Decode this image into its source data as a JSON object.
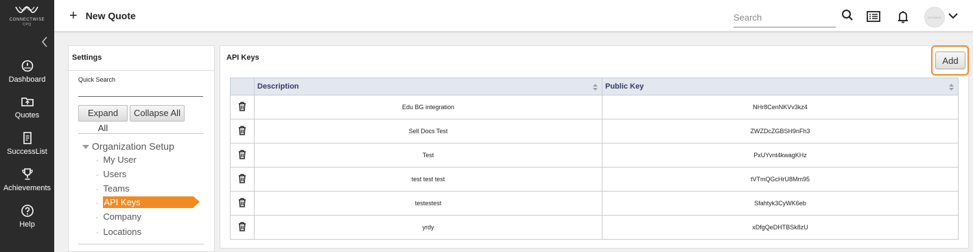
{
  "sidebar": {
    "logo": {
      "line1": "CONNECTWISE",
      "line2": "CPQ"
    },
    "items": [
      {
        "label": "Dashboard",
        "icon": "dashboard-gauge-icon"
      },
      {
        "label": "Quotes",
        "icon": "quotes-folder-icon"
      },
      {
        "label": "SuccessList",
        "icon": "successlist-clipboard-icon"
      },
      {
        "label": "Achievements",
        "icon": "trophy-icon"
      },
      {
        "label": "Help",
        "icon": "help-question-icon"
      }
    ]
  },
  "topbar": {
    "new_quote_label": "New Quote",
    "search_placeholder": "Search",
    "avatar_text": "NO IMAGE"
  },
  "settings": {
    "title": "Settings",
    "quick_search_label": "Quick Search",
    "expand_all": "Expand All",
    "collapse_all": "Collapse All",
    "tree": {
      "root": "Organization Setup",
      "items": [
        "My User",
        "Users",
        "Teams",
        "API Keys",
        "Company",
        "Locations"
      ],
      "active": "API Keys"
    }
  },
  "api_keys": {
    "title": "API Keys",
    "add_label": "Add",
    "columns": [
      "Description",
      "Public Key"
    ],
    "rows": [
      {
        "description": "Edu BG integration",
        "public_key": "NHr8CenNKVv3kz4"
      },
      {
        "description": "Sell Docs Test",
        "public_key": "ZWZDcZGBSH9nFh3"
      },
      {
        "description": "Test",
        "public_key": "PxUYvnt4kwagKHz"
      },
      {
        "description": "test test test",
        "public_key": "tVTmQGcHrU8Mm95"
      },
      {
        "description": "testestest",
        "public_key": "Sfahtyk3CyWK6eb"
      },
      {
        "description": "yrdy",
        "public_key": "xDfgQeDHTBSk8zU"
      }
    ]
  },
  "colors": {
    "sidebar_bg": "#2b2b2b",
    "accent": "#f28a22",
    "table_header_bg": "#e3e7ee"
  }
}
